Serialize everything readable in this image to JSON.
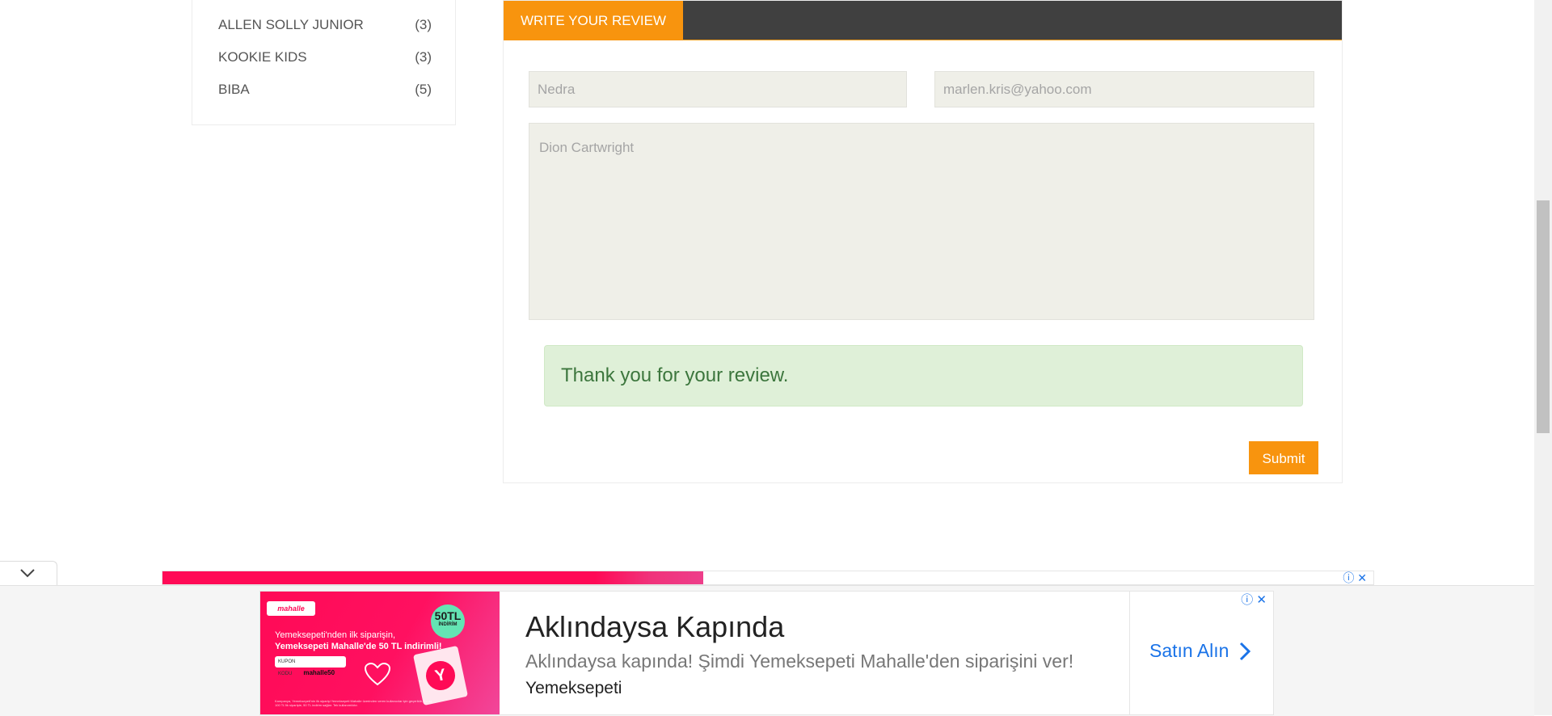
{
  "sidebar": {
    "brands": [
      {
        "name": "ALLEN SOLLY JUNIOR",
        "count": "(3)"
      },
      {
        "name": "KOOKIE KIDS",
        "count": "(3)"
      },
      {
        "name": "BIBA",
        "count": "(5)"
      }
    ]
  },
  "review": {
    "tab_label": "WRITE YOUR REVIEW",
    "name_value": "Nedra",
    "email_value": "marlen.kris@yahoo.com",
    "message_value": "Dion Cartwright",
    "success_message": "Thank you for your review.",
    "submit_label": "Submit"
  },
  "ad": {
    "strip_info_icon": "info-icon",
    "strip_close_icon": "close-icon",
    "image": {
      "logo": "mahalle",
      "badge_amount": "50TL",
      "badge_label": "İNDİRİM",
      "line1": "Yemeksepeti'nden ilk siparişin,",
      "line2": "Yemeksepeti Mahalle'de 50 TL indirimli!",
      "code_label": "KUPON KODU",
      "code": "mahalle50",
      "fine_print": "Kampanya, Yemeksepeti'nin ilk siparişi Yemeksepeti Mahalle üzerinden veren kullanıcılar için geçerlidir. En az 100 TL'lik siparişte, 50 TL indirim sağlar. Tek kullanımlıktır.",
      "ticket_letter": "Y"
    },
    "title": "Aklındaysa Kapında",
    "description": "Aklındaysa kapında! Şimdi Yemeksepeti Mahalle'den siparişini ver!",
    "advertiser": "Yemeksepeti",
    "cta": "Satın Alın",
    "accent": "#ff0a56",
    "link_color": "#1a73e8"
  },
  "colors": {
    "primary_orange": "#f8940e",
    "header_dark": "#404040",
    "success_bg": "#dff0d8",
    "success_text": "#3c763d"
  }
}
